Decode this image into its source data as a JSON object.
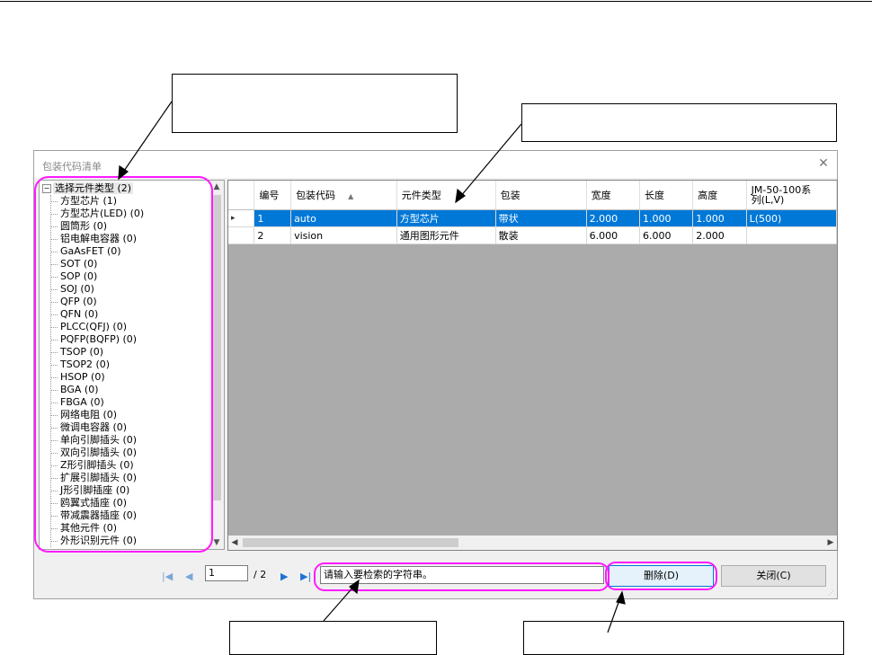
{
  "dialog": {
    "title": "包装代码清单",
    "close_icon": "close-icon"
  },
  "tree": {
    "root_toggle": "⊟",
    "root_label": "选择元件类型 (2)",
    "items": [
      "方型芯片 (1)",
      "方型芯片(LED) (0)",
      "圆筒形 (0)",
      "铝电解电容器 (0)",
      "GaAsFET (0)",
      "SOT (0)",
      "SOP (0)",
      "SOJ (0)",
      "QFP (0)",
      "QFN (0)",
      "PLCC(QFJ) (0)",
      "PQFP(BQFP) (0)",
      "TSOP (0)",
      "TSOP2 (0)",
      "HSOP (0)",
      "BGA (0)",
      "FBGA (0)",
      "网络电阻 (0)",
      "微调电容器 (0)",
      "单向引脚插头 (0)",
      "双向引脚插头 (0)",
      "Z形引脚插头 (0)",
      "扩展引脚插头 (0)",
      "J形引脚插座 (0)",
      "鸥翼式插座 (0)",
      "带减震器插座 (0)",
      "其他元件 (0)",
      "外形识别元件 (0)"
    ]
  },
  "grid": {
    "headers": [
      "编号",
      "包装代码",
      "元件类型",
      "包装",
      "宽度",
      "长度",
      "高度",
      "JM-50-100系\n列(L,V)"
    ],
    "sort_arrow": "▲",
    "row_indicator": "▸",
    "rows": [
      [
        "1",
        "auto",
        "方型芯片",
        "带状",
        "2.000",
        "1.000",
        "1.000",
        "L(500)"
      ],
      [
        "2",
        "vision",
        "通用图形元件",
        "散装",
        "6.000",
        "6.000",
        "2.000",
        ""
      ]
    ]
  },
  "pager": {
    "first": "|◀",
    "prev": "◀",
    "current_page": "1",
    "total": "/ 2",
    "next": "▶",
    "last": "▶|"
  },
  "search": {
    "placeholder": "请输入要检索的字符串。"
  },
  "buttons": {
    "delete": "删除(D)",
    "close": "关闭(C)"
  },
  "colors": {
    "highlight": "#ff1aff",
    "selection": "#0078d7"
  }
}
